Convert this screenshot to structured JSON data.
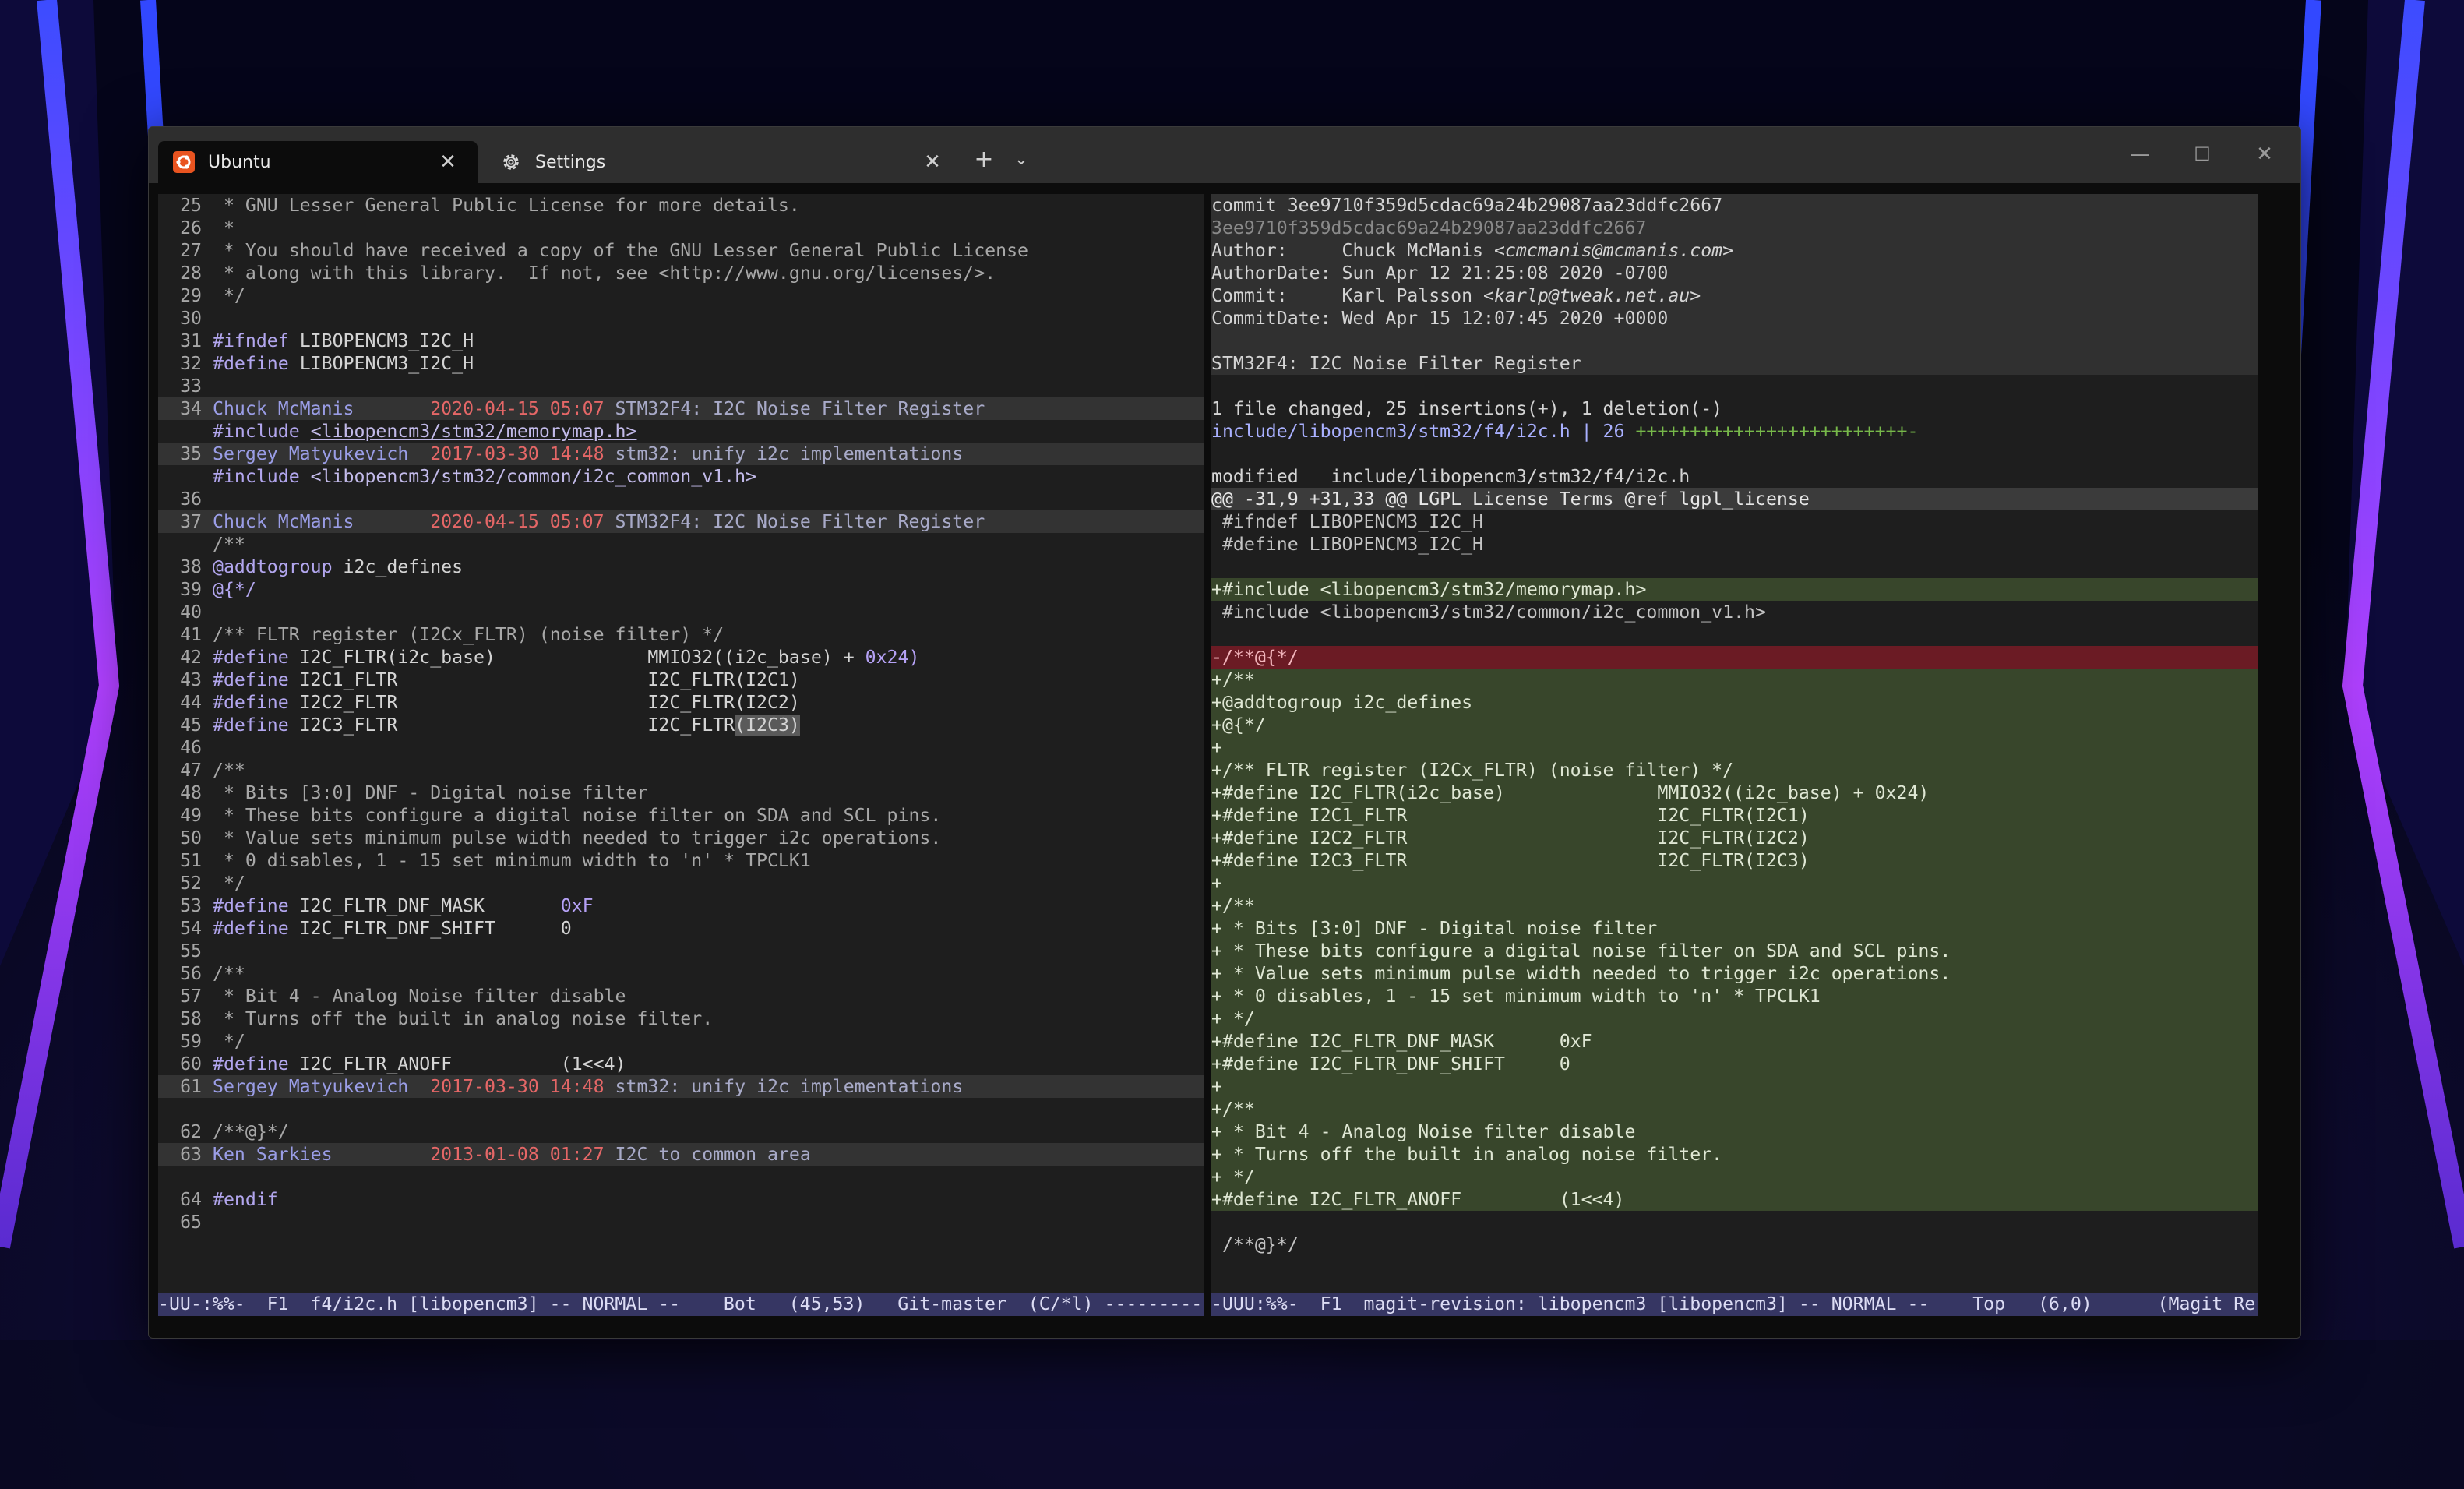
{
  "tabs": [
    {
      "label": "Ubuntu",
      "icon": "ubuntu-icon",
      "active": true
    },
    {
      "label": "Settings",
      "icon": "gear-icon",
      "active": false
    }
  ],
  "colors": {
    "accent_ubuntu": "#e95420",
    "statusbar": "#363663",
    "diff_add": "#38462b",
    "diff_del": "#6b1b24"
  },
  "left_pane": {
    "lines": [
      {
        "n": "25",
        "t": " * GNU Lesser General Public License for more details."
      },
      {
        "n": "26",
        "t": " *"
      },
      {
        "n": "27",
        "t": " * You should have received a copy of the GNU Lesser General Public License"
      },
      {
        "n": "28",
        "t": " * along with this library.  If not, see <http://www.gnu.org/licenses/>."
      },
      {
        "n": "29",
        "t": " */"
      },
      {
        "n": "30",
        "t": ""
      },
      {
        "n": "31",
        "t": "#ifndef LIBOPENCM3_I2C_H"
      },
      {
        "n": "32",
        "t": "#define LIBOPENCM3_I2C_H"
      },
      {
        "n": "33",
        "t": ""
      },
      {
        "n": "34",
        "blame": {
          "name": "Chuck McManis",
          "date": "2020-04-15 05:07",
          "msg": "STM32F4: I2C Noise Filter Register"
        }
      },
      {
        "n": "",
        "t": "#include <libopencm3/stm32/memorymap.h>"
      },
      {
        "n": "35",
        "blame": {
          "name": "Sergey Matyukevich",
          "date": "2017-03-30 14:48",
          "msg": "stm32: unify i2c implementations"
        }
      },
      {
        "n": "",
        "t": "#include <libopencm3/stm32/common/i2c_common_v1.h>"
      },
      {
        "n": "36",
        "t": ""
      },
      {
        "n": "37",
        "blame": {
          "name": "Chuck McManis",
          "date": "2020-04-15 05:07",
          "msg": "STM32F4: I2C Noise Filter Register"
        }
      },
      {
        "n": "",
        "t": "/**"
      },
      {
        "n": "38",
        "t": "@addtogroup i2c_defines"
      },
      {
        "n": "39",
        "t": "@{*/"
      },
      {
        "n": "40",
        "t": ""
      },
      {
        "n": "41",
        "t": "/** FLTR register (I2Cx_FLTR) (noise filter) */"
      },
      {
        "n": "42",
        "t": "#define I2C_FLTR(i2c_base)              MMIO32((i2c_base) + 0x24)"
      },
      {
        "n": "43",
        "t": "#define I2C1_FLTR                       I2C_FLTR(I2C1)"
      },
      {
        "n": "44",
        "t": "#define I2C2_FLTR                       I2C_FLTR(I2C2)"
      },
      {
        "n": "45",
        "t": "#define I2C3_FLTR                       I2C_FLTR(I2C3)"
      },
      {
        "n": "46",
        "t": ""
      },
      {
        "n": "47",
        "t": "/**"
      },
      {
        "n": "48",
        "t": " * Bits [3:0] DNF - Digital noise filter"
      },
      {
        "n": "49",
        "t": " * These bits configure a digital noise filter on SDA and SCL pins."
      },
      {
        "n": "50",
        "t": " * Value sets minimum pulse width needed to trigger i2c operations."
      },
      {
        "n": "51",
        "t": " * 0 disables, 1 - 15 set minimum width to 'n' * TPCLK1"
      },
      {
        "n": "52",
        "t": " */"
      },
      {
        "n": "53",
        "t": "#define I2C_FLTR_DNF_MASK       0xF"
      },
      {
        "n": "54",
        "t": "#define I2C_FLTR_DNF_SHIFT      0"
      },
      {
        "n": "55",
        "t": ""
      },
      {
        "n": "56",
        "t": "/**"
      },
      {
        "n": "57",
        "t": " * Bit 4 - Analog Noise filter disable"
      },
      {
        "n": "58",
        "t": " * Turns off the built in analog noise filter."
      },
      {
        "n": "59",
        "t": " */"
      },
      {
        "n": "60",
        "t": "#define I2C_FLTR_ANOFF          (1<<4)"
      },
      {
        "n": "61",
        "blame": {
          "name": "Sergey Matyukevich",
          "date": "2017-03-30 14:48",
          "msg": "stm32: unify i2c implementations"
        }
      },
      {
        "n": "",
        "t": ""
      },
      {
        "n": "62",
        "t": "/**@}*/"
      },
      {
        "n": "63",
        "blame": {
          "name": "Ken Sarkies",
          "date": "2013-01-08 01:27",
          "msg": "I2C to common area"
        }
      },
      {
        "n": "",
        "t": ""
      },
      {
        "n": "64",
        "t": "#endif"
      },
      {
        "n": "65",
        "t": ""
      }
    ],
    "status": "-UU-:%%-  F1  f4/i2c.h [libopencm3] -- NORMAL --    Bot   (45,53)   Git-master  (C/*l) ---------"
  },
  "right_pane": {
    "lines": [
      {
        "k": "hdr",
        "t": "commit 3ee9710f359d5cdac69a24b29087aa23ddfc2667"
      },
      {
        "k": "hdr-dim",
        "t": "3ee9710f359d5cdac69a24b29087aa23ddfc2667"
      },
      {
        "k": "hdr",
        "t": "Author:     Chuck McManis ",
        "em": "<cmcmanis@mcmanis.com>"
      },
      {
        "k": "hdr",
        "t": "AuthorDate: Sun Apr 12 21:25:08 2020 -0700"
      },
      {
        "k": "hdr",
        "t": "Commit:     Karl Palsson ",
        "em": "<karlp@tweak.net.au>"
      },
      {
        "k": "hdr",
        "t": "CommitDate: Wed Apr 15 12:07:45 2020 +0000"
      },
      {
        "k": "hdr",
        "t": ""
      },
      {
        "k": "hdr",
        "t": "STM32F4: I2C Noise Filter Register"
      },
      {
        "k": "plain",
        "t": ""
      },
      {
        "k": "plain",
        "t": "1 file changed, 25 insertions(+), 1 deletion(-)"
      },
      {
        "k": "stat",
        "t": "include/libopencm3/stm32/f4/i2c.h | 26 ",
        "plus": "+++++++++++++++++++++++++-"
      },
      {
        "k": "plain",
        "t": ""
      },
      {
        "k": "plain",
        "t": "modified   include/libopencm3/stm32/f4/i2c.h"
      },
      {
        "k": "hunk",
        "t": "@@ -31,9 +31,33 @@ LGPL License Terms @ref lgpl_license"
      },
      {
        "k": "ctx",
        "t": " #ifndef LIBOPENCM3_I2C_H"
      },
      {
        "k": "ctx",
        "t": " #define LIBOPENCM3_I2C_H"
      },
      {
        "k": "ctx",
        "t": ""
      },
      {
        "k": "add",
        "t": "+#include <libopencm3/stm32/memorymap.h>"
      },
      {
        "k": "ctx",
        "t": " #include <libopencm3/stm32/common/i2c_common_v1.h>"
      },
      {
        "k": "ctx",
        "t": ""
      },
      {
        "k": "del",
        "t": "-/**@{*/"
      },
      {
        "k": "add",
        "t": "+/**"
      },
      {
        "k": "add",
        "t": "+@addtogroup i2c_defines"
      },
      {
        "k": "add",
        "t": "+@{*/"
      },
      {
        "k": "add",
        "t": "+"
      },
      {
        "k": "add",
        "t": "+/** FLTR register (I2Cx_FLTR) (noise filter) */"
      },
      {
        "k": "add",
        "t": "+#define I2C_FLTR(i2c_base)              MMIO32((i2c_base) + 0x24)"
      },
      {
        "k": "add",
        "t": "+#define I2C1_FLTR                       I2C_FLTR(I2C1)"
      },
      {
        "k": "add",
        "t": "+#define I2C2_FLTR                       I2C_FLTR(I2C2)"
      },
      {
        "k": "add",
        "t": "+#define I2C3_FLTR                       I2C_FLTR(I2C3)"
      },
      {
        "k": "add",
        "t": "+"
      },
      {
        "k": "add",
        "t": "+/**"
      },
      {
        "k": "add",
        "t": "+ * Bits [3:0] DNF - Digital noise filter"
      },
      {
        "k": "add",
        "t": "+ * These bits configure a digital noise filter on SDA and SCL pins."
      },
      {
        "k": "add",
        "t": "+ * Value sets minimum pulse width needed to trigger i2c operations."
      },
      {
        "k": "add",
        "t": "+ * 0 disables, 1 - 15 set minimum width to 'n' * TPCLK1"
      },
      {
        "k": "add",
        "t": "+ */"
      },
      {
        "k": "add",
        "t": "+#define I2C_FLTR_DNF_MASK      0xF"
      },
      {
        "k": "add",
        "t": "+#define I2C_FLTR_DNF_SHIFT     0"
      },
      {
        "k": "add",
        "t": "+"
      },
      {
        "k": "add",
        "t": "+/**"
      },
      {
        "k": "add",
        "t": "+ * Bit 4 - Analog Noise filter disable"
      },
      {
        "k": "add",
        "t": "+ * Turns off the built in analog noise filter."
      },
      {
        "k": "add",
        "t": "+ */"
      },
      {
        "k": "add",
        "t": "+#define I2C_FLTR_ANOFF         (1<<4)"
      },
      {
        "k": "ctx",
        "t": ""
      },
      {
        "k": "ctx",
        "t": " /**@}*/"
      }
    ],
    "status": "-UUU:%%-  F1  magit-revision: libopencm3 [libopencm3] -- NORMAL --    Top   (6,0)      (Magit Re"
  }
}
